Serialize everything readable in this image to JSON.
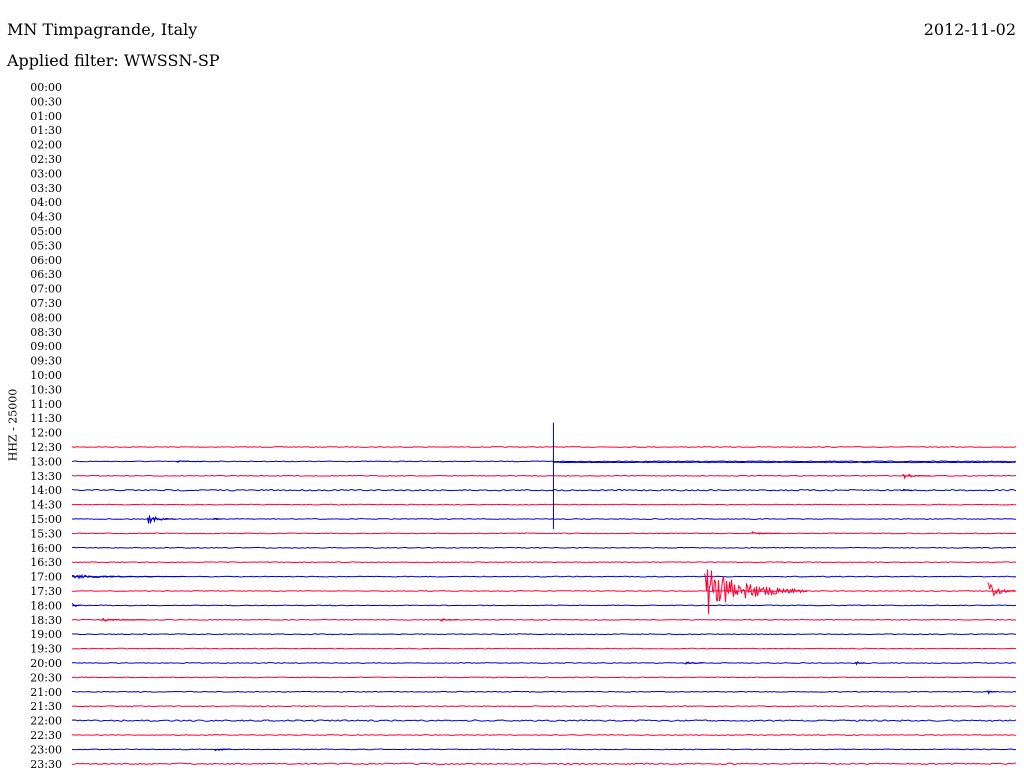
{
  "header": {
    "station": "MN Timpagrande, Italy",
    "date": "2012-11-02",
    "filter": "Applied filter: WWSSN-SP"
  },
  "chart_data": {
    "type": "line",
    "title": "MN Timpagrande, Italy",
    "subtitle": "Applied filter: WWSSN-SP",
    "ylabel": "HHZ - 25000",
    "row_labels": [
      "00:00",
      "00:30",
      "01:00",
      "01:30",
      "02:00",
      "02:30",
      "03:00",
      "03:30",
      "04:00",
      "04:30",
      "05:00",
      "05:30",
      "06:00",
      "06:30",
      "07:00",
      "07:30",
      "08:00",
      "08:30",
      "09:00",
      "09:30",
      "10:00",
      "10:30",
      "11:00",
      "11:30",
      "12:00",
      "12:30",
      "13:00",
      "13:30",
      "14:00",
      "14:30",
      "15:00",
      "15:30",
      "16:00",
      "16:30",
      "17:00",
      "17:30",
      "18:00",
      "18:30",
      "19:00",
      "19:30",
      "20:00",
      "20:30",
      "21:00",
      "21:30",
      "22:00",
      "22:30",
      "23:00",
      "23:30"
    ],
    "row_duration_min": 30,
    "colors": {
      "odd": "#ff0033",
      "even": "#0000cc"
    },
    "data_start_min": 60,
    "offset_trace": {
      "from_row": "12:30",
      "from_min": 0.51
    },
    "spike": {
      "row": "12:00",
      "at_min": 0.51
    },
    "events": [
      {
        "row": "13:00",
        "at_min": 0.11,
        "amp": 1,
        "dur_min": 0.03
      },
      {
        "row": "13:30",
        "at_min": 0.88,
        "amp": 3,
        "dur_min": 0.03
      },
      {
        "row": "14:00",
        "at_min": 0.88,
        "amp": 2,
        "dur_min": 0.01
      },
      {
        "row": "15:00",
        "at_min": 0.08,
        "amp": 5,
        "dur_min": 0.03
      },
      {
        "row": "15:00",
        "at_min": 0.15,
        "amp": 2,
        "dur_min": 0.01
      },
      {
        "row": "15:30",
        "at_min": 0.72,
        "amp": 2,
        "dur_min": 0.03
      },
      {
        "row": "17:00",
        "at_min": 0.0,
        "amp": 2,
        "dur_min": 0.12
      },
      {
        "row": "17:30",
        "at_min": 0.67,
        "amp": 26,
        "dur_min": 0.11
      },
      {
        "row": "17:30",
        "at_min": 0.97,
        "amp": 9,
        "dur_min": 0.03
      },
      {
        "row": "18:00",
        "at_min": 0.0,
        "amp": 3,
        "dur_min": 0.01
      },
      {
        "row": "18:30",
        "at_min": 0.03,
        "amp": 2,
        "dur_min": 0.05
      },
      {
        "row": "18:30",
        "at_min": 0.39,
        "amp": 2,
        "dur_min": 0.02
      },
      {
        "row": "20:00",
        "at_min": 0.65,
        "amp": 2,
        "dur_min": 0.02
      },
      {
        "row": "20:00",
        "at_min": 0.83,
        "amp": 2,
        "dur_min": 0.01
      },
      {
        "row": "21:00",
        "at_min": 0.97,
        "amp": 3,
        "dur_min": 0.01
      },
      {
        "row": "23:00",
        "at_min": 0.15,
        "amp": 2,
        "dur_min": 0.02
      }
    ]
  }
}
